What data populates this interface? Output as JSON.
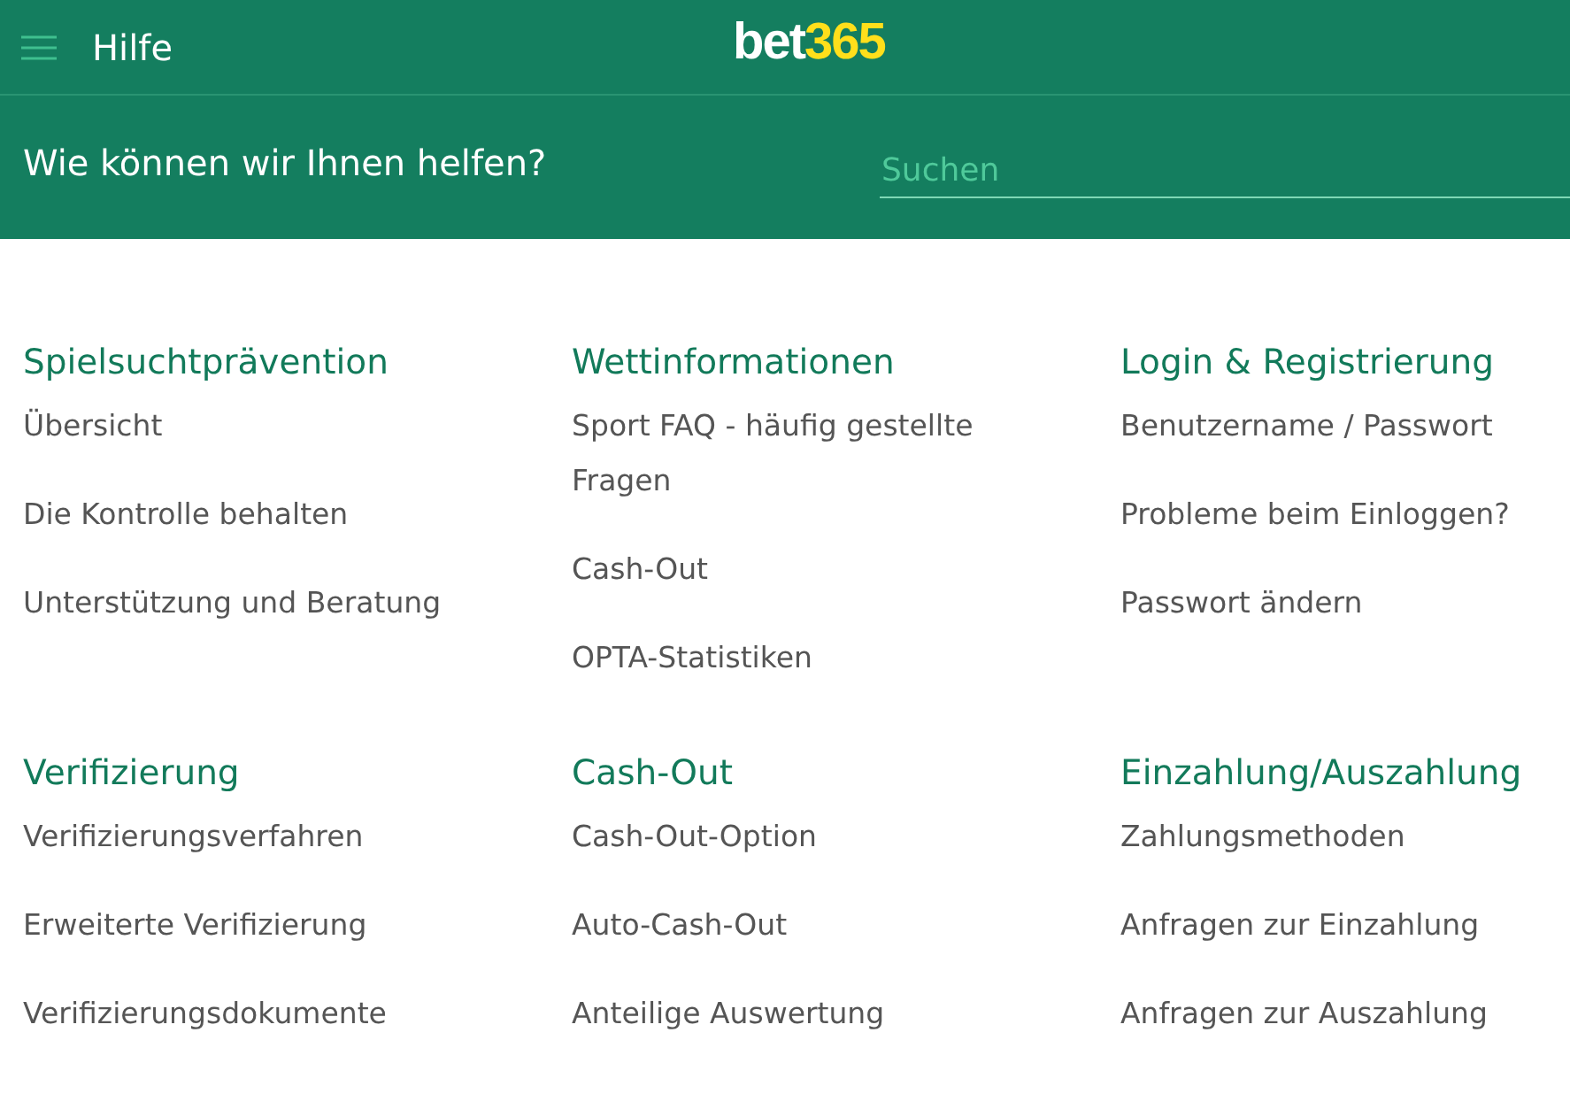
{
  "header": {
    "menu_label": "Hilfe",
    "logo": {
      "primary": "bet",
      "accent": "365"
    }
  },
  "search_band": {
    "title": "Wie können wir Ihnen helfen?",
    "search": {
      "placeholder": "Suchen"
    }
  },
  "sections": [
    {
      "title": "Spielsuchtprävention",
      "links": [
        "Übersicht",
        "Die Kontrolle behalten",
        "Unterstützung und Beratung"
      ]
    },
    {
      "title": "Wettinformationen",
      "links": [
        "Sport FAQ - häufig gestellte Fragen",
        "Cash-Out",
        "OPTA-Statistiken"
      ]
    },
    {
      "title": "Login & Registrierung",
      "links": [
        "Benutzername / Passwort",
        "Probleme beim Einloggen?",
        "Passwort ändern"
      ]
    },
    {
      "title": "Verifizierung",
      "links": [
        "Verifizierungsverfahren",
        "Erweiterte Verifizierung",
        "Verifizierungsdokumente"
      ]
    },
    {
      "title": "Cash-Out",
      "links": [
        "Cash-Out-Option",
        "Auto-Cash-Out",
        "Anteilige Auswertung"
      ]
    },
    {
      "title": "Einzahlung/Auszahlung",
      "links": [
        "Zahlungsmethoden",
        "Anfragen zur Einzahlung",
        "Anfragen zur Auszahlung"
      ]
    }
  ]
}
